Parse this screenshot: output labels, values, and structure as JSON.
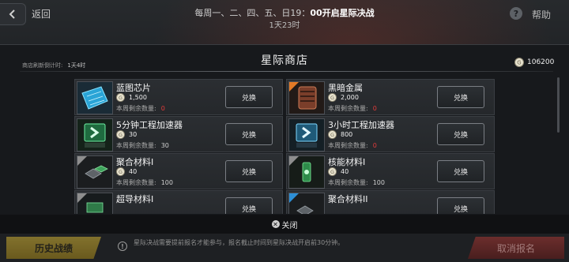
{
  "topbar": {
    "back_label": "返回",
    "schedule_prefix": "每周一、二、四、五、日19：",
    "schedule_time": "00开启星际决战",
    "countdown": "1天23时",
    "help_label": "帮助",
    "help_icon": "question-icon"
  },
  "shop": {
    "title": "星际商店",
    "refresh_label": "商店刷新倒计时:",
    "refresh_value": "1天4时",
    "balance": "106200",
    "currency_icon": "coin-icon",
    "items": [
      {
        "name": "蓝图芯片",
        "price": "1,500",
        "remain_label": "本周剩余数量:",
        "remain": "0",
        "button": "兑换",
        "icon": "blueprint-chip-icon",
        "tag": "none"
      },
      {
        "name": "黑暗金属",
        "price": "2,000",
        "remain_label": "本周剩余数量:",
        "remain": "0",
        "button": "兑换",
        "icon": "dark-metal-icon",
        "tag": "orange"
      },
      {
        "name": "5分钟工程加速器",
        "price": "30",
        "remain_label": "本周剩余数量:",
        "remain": "30",
        "button": "兑换",
        "icon": "speedup-5min-icon",
        "tag": "none"
      },
      {
        "name": "3小时工程加速器",
        "price": "800",
        "remain_label": "本周剩余数量:",
        "remain": "0",
        "button": "兑换",
        "icon": "speedup-3h-icon",
        "tag": "none"
      },
      {
        "name": "聚合材料I",
        "price": "40",
        "remain_label": "本周剩余数量:",
        "remain": "100",
        "button": "兑换",
        "icon": "polymer-material-icon",
        "tag": "gray"
      },
      {
        "name": "核能材料I",
        "price": "40",
        "remain_label": "本周剩余数量:",
        "remain": "100",
        "button": "兑换",
        "icon": "nuclear-material-icon",
        "tag": "gray"
      },
      {
        "name": "超导材料I",
        "price": "",
        "remain_label": "",
        "remain": "",
        "button": "兑换",
        "icon": "superconductor-material-icon",
        "tag": "gray"
      },
      {
        "name": "聚合材料II",
        "price": "",
        "remain_label": "",
        "remain": "",
        "button": "兑换",
        "icon": "polymer-material-icon",
        "tag": "blue"
      }
    ]
  },
  "close_label": "关闭",
  "bottom": {
    "history_label": "历史战绩",
    "notice": "星际决战需要提前报名才能参与，报名截止时间到星际决战开启前30分钟。",
    "cancel_label": "取消报名"
  }
}
